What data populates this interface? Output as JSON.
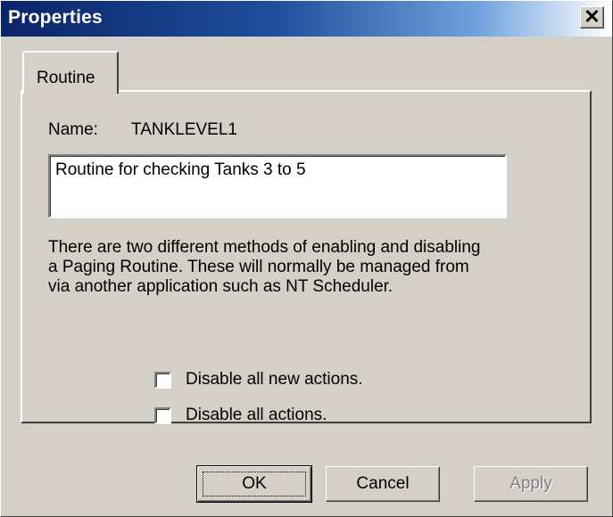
{
  "window": {
    "title": "Properties",
    "close_glyph": "✕"
  },
  "tabs": [
    {
      "label": "Routine",
      "active": true
    }
  ],
  "routine": {
    "name_label": "Name:",
    "name_value": "TANKLEVEL1",
    "description": "Routine for checking Tanks 3 to 5",
    "info_text": "There are two different methods of enabling and disabling a Paging Routine. These will normally be managed from via another application such as NT Scheduler.",
    "checkboxes": [
      {
        "label": "Disable all new actions.",
        "checked": false
      },
      {
        "label": "Disable all actions.",
        "checked": false
      }
    ]
  },
  "buttons": {
    "ok": "OK",
    "cancel": "Cancel",
    "apply": "Apply",
    "apply_enabled": false
  },
  "colors": {
    "title_gradient_start": "#0a246a",
    "title_gradient_end": "#ffffff",
    "face": "#d4d0c8",
    "disabled_text": "#808080"
  }
}
